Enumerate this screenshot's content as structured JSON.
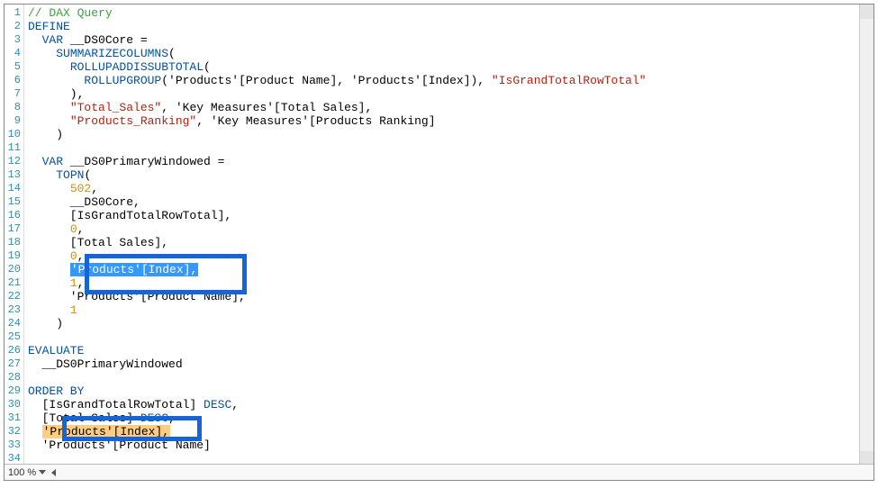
{
  "zoom": {
    "level": "100 %"
  },
  "lines": [
    {
      "n": 1,
      "segs": [
        {
          "t": "// DAX Query",
          "c": "c-comment"
        }
      ]
    },
    {
      "n": 2,
      "segs": [
        {
          "t": "DEFINE",
          "c": "c-kw"
        }
      ]
    },
    {
      "n": 3,
      "segs": [
        {
          "t": "  ",
          "c": ""
        },
        {
          "t": "VAR",
          "c": "c-kw"
        },
        {
          "t": " __DS0Core =",
          "c": "c-text"
        }
      ]
    },
    {
      "n": 4,
      "segs": [
        {
          "t": "    ",
          "c": ""
        },
        {
          "t": "SUMMARIZECOLUMNS",
          "c": "c-func"
        },
        {
          "t": "(",
          "c": "c-text"
        }
      ]
    },
    {
      "n": 5,
      "segs": [
        {
          "t": "      ",
          "c": ""
        },
        {
          "t": "ROLLUPADDISSUBTOTAL",
          "c": "c-func"
        },
        {
          "t": "(",
          "c": "c-text"
        }
      ]
    },
    {
      "n": 6,
      "segs": [
        {
          "t": "        ",
          "c": ""
        },
        {
          "t": "ROLLUPGROUP",
          "c": "c-func"
        },
        {
          "t": "('Products'[Product Name], 'Products'[Index]), ",
          "c": "c-text"
        },
        {
          "t": "\"IsGrandTotalRowTotal\"",
          "c": "c-str"
        }
      ]
    },
    {
      "n": 7,
      "segs": [
        {
          "t": "      ),",
          "c": "c-text"
        }
      ]
    },
    {
      "n": 8,
      "segs": [
        {
          "t": "      ",
          "c": ""
        },
        {
          "t": "\"Total_Sales\"",
          "c": "c-str"
        },
        {
          "t": ", 'Key Measures'[Total Sales],",
          "c": "c-text"
        }
      ]
    },
    {
      "n": 9,
      "segs": [
        {
          "t": "      ",
          "c": ""
        },
        {
          "t": "\"Products_Ranking\"",
          "c": "c-str"
        },
        {
          "t": ", 'Key Measures'[Products Ranking]",
          "c": "c-text"
        }
      ]
    },
    {
      "n": 10,
      "segs": [
        {
          "t": "    )",
          "c": "c-text"
        }
      ]
    },
    {
      "n": 11,
      "segs": [
        {
          "t": "",
          "c": ""
        }
      ]
    },
    {
      "n": 12,
      "segs": [
        {
          "t": "  ",
          "c": ""
        },
        {
          "t": "VAR",
          "c": "c-kw"
        },
        {
          "t": " __DS0PrimaryWindowed =",
          "c": "c-text"
        }
      ]
    },
    {
      "n": 13,
      "segs": [
        {
          "t": "    ",
          "c": ""
        },
        {
          "t": "TOPN",
          "c": "c-func"
        },
        {
          "t": "(",
          "c": "c-text"
        }
      ]
    },
    {
      "n": 14,
      "segs": [
        {
          "t": "      ",
          "c": ""
        },
        {
          "t": "502",
          "c": "c-num"
        },
        {
          "t": ",",
          "c": "c-text"
        }
      ]
    },
    {
      "n": 15,
      "segs": [
        {
          "t": "      __DS0Core,",
          "c": "c-text"
        }
      ]
    },
    {
      "n": 16,
      "segs": [
        {
          "t": "      [IsGrandTotalRowTotal],",
          "c": "c-text"
        }
      ]
    },
    {
      "n": 17,
      "segs": [
        {
          "t": "      ",
          "c": ""
        },
        {
          "t": "0",
          "c": "c-num"
        },
        {
          "t": ",",
          "c": "c-text"
        }
      ]
    },
    {
      "n": 18,
      "segs": [
        {
          "t": "      [Total Sales],",
          "c": "c-text"
        }
      ]
    },
    {
      "n": 19,
      "segs": [
        {
          "t": "      ",
          "c": ""
        },
        {
          "t": "0",
          "c": "c-num"
        },
        {
          "t": ",",
          "c": "c-text"
        }
      ]
    },
    {
      "n": 20,
      "segs": [
        {
          "t": "      ",
          "c": ""
        },
        {
          "t": "'Products'[Index],",
          "c": "sel-blue"
        }
      ]
    },
    {
      "n": 21,
      "segs": [
        {
          "t": "      ",
          "c": ""
        },
        {
          "t": "1",
          "c": "c-num"
        },
        {
          "t": ",",
          "c": "c-text"
        }
      ]
    },
    {
      "n": 22,
      "segs": [
        {
          "t": "      'Products'[Product Name],",
          "c": "c-text"
        }
      ]
    },
    {
      "n": 23,
      "segs": [
        {
          "t": "      ",
          "c": ""
        },
        {
          "t": "1",
          "c": "c-num"
        }
      ]
    },
    {
      "n": 24,
      "segs": [
        {
          "t": "    )",
          "c": "c-text"
        }
      ]
    },
    {
      "n": 25,
      "segs": [
        {
          "t": "",
          "c": ""
        }
      ]
    },
    {
      "n": 26,
      "segs": [
        {
          "t": "EVALUATE",
          "c": "c-kw"
        }
      ]
    },
    {
      "n": 27,
      "segs": [
        {
          "t": "  __DS0PrimaryWindowed",
          "c": "c-text"
        }
      ]
    },
    {
      "n": 28,
      "segs": [
        {
          "t": "",
          "c": ""
        }
      ]
    },
    {
      "n": 29,
      "segs": [
        {
          "t": "ORDER BY",
          "c": "c-kw"
        }
      ]
    },
    {
      "n": 30,
      "segs": [
        {
          "t": "  [IsGrandTotalRowTotal] ",
          "c": "c-text"
        },
        {
          "t": "DESC",
          "c": "c-kw"
        },
        {
          "t": ",",
          "c": "c-text"
        }
      ]
    },
    {
      "n": 31,
      "segs": [
        {
          "t": "  ",
          "c": ""
        },
        {
          "t": "[Total Sales] ",
          "c": "c-text"
        },
        {
          "t": "DESC",
          "c": "c-kw"
        },
        {
          "t": ",",
          "c": "c-text"
        }
      ]
    },
    {
      "n": 32,
      "segs": [
        {
          "t": "  ",
          "c": ""
        },
        {
          "t": "'Products'[Index],",
          "c": "sel-orange"
        }
      ]
    },
    {
      "n": 33,
      "segs": [
        {
          "t": "  ",
          "c": ""
        },
        {
          "t": "'Products'[Product ",
          "c": "c-text"
        },
        {
          "t": "Name]",
          "c": "c-text"
        }
      ]
    },
    {
      "n": 34,
      "segs": [
        {
          "t": "",
          "c": ""
        }
      ]
    }
  ]
}
